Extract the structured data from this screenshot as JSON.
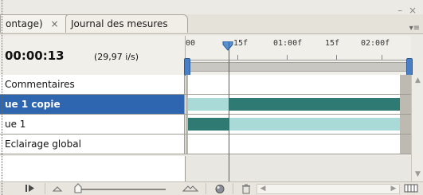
{
  "tabs": [
    {
      "label": "ontage)",
      "close": "×"
    },
    {
      "label": "Journal des mesures"
    }
  ],
  "window_controls": "– ×",
  "panel_menu_icon": "▾≡",
  "timecode": "00:00:13",
  "fps": "(29,97 i/s)",
  "ruler": {
    "labels": [
      "00",
      "15f",
      "01:00f",
      "15f",
      "02:00f"
    ]
  },
  "layers": [
    {
      "label": "Commentaires",
      "selected": false
    },
    {
      "label": "ue 1 copie",
      "selected": true
    },
    {
      "label": "ue 1",
      "selected": false
    },
    {
      "label": "Eclairage global",
      "selected": false
    }
  ],
  "colors": {
    "selected_row": "#2f66b0",
    "bar_light": "#a9dad7",
    "bar_dark": "#2f7a73",
    "playhead": "#c23030",
    "work_bracket": "#4a7fc5"
  },
  "bottom_icons": [
    "play-icon",
    "zoom-out-icon",
    "zoom-in-icon",
    "tween-icon",
    "new-layer-icon",
    "trash-icon",
    "scroll-left-icon",
    "scroll-right-icon",
    "timeline-view-icon"
  ]
}
